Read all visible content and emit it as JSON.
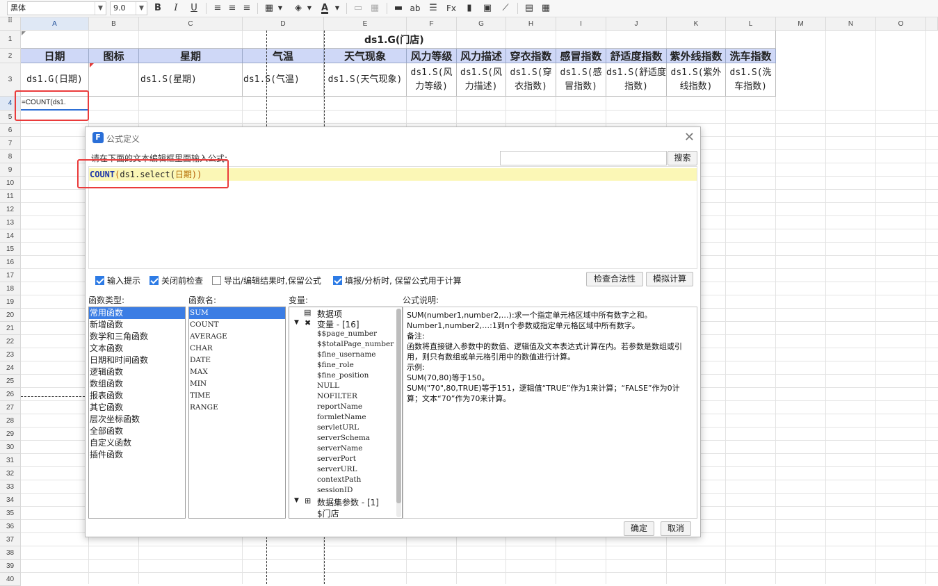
{
  "toolbar": {
    "font_name": "黑体",
    "font_size": "9.0",
    "bold": "B",
    "italic": "I",
    "underline": "U",
    "font_color_glyph": "A",
    "text_ab": "ab",
    "fx": "Fx"
  },
  "sheet": {
    "columns": [
      "A",
      "B",
      "C",
      "D",
      "E",
      "F",
      "G",
      "H",
      "I",
      "J",
      "K",
      "L",
      "M",
      "N",
      "O"
    ],
    "rows": [
      "1",
      "2",
      "3",
      "4",
      "5",
      "6",
      "7",
      "8",
      "9",
      "10",
      "11",
      "12",
      "13",
      "14",
      "15",
      "16",
      "17",
      "18",
      "19",
      "20",
      "21",
      "22",
      "23",
      "24",
      "25",
      "26",
      "27",
      "28",
      "29",
      "30",
      "31",
      "32",
      "33",
      "34",
      "35",
      "36",
      "37",
      "38",
      "39",
      "40"
    ],
    "title_cell": "ds1.G(门店)",
    "headers": [
      "日期",
      "图标",
      "星期",
      "气温",
      "天气现象",
      "风力等级",
      "风力描述",
      "穿衣指数",
      "感冒指数",
      "舒适度指数",
      "紫外线指数",
      "洗车指数"
    ],
    "data_cells": [
      "ds1.G(日期)",
      "",
      "ds1.S(星期)",
      "ds1.S(气温)",
      "ds1.S(天气现象)",
      "ds1.S(风力等级)",
      "ds1.S(风力描述)",
      "ds1.S(穿衣指数)",
      "ds1.S(感冒指数)",
      "ds1.S(舒适度指数)",
      "ds1.S(紫外线指数)",
      "ds1.S(洗车指数)"
    ],
    "editing_cell": "=COUNT(ds1."
  },
  "dialog": {
    "title": "公式定义",
    "prompt": "请在下面的文本编辑框里面输入公式:",
    "search_button": "搜索",
    "formula": {
      "func": "COUNT",
      "open": "(",
      "body": "ds1.select(",
      "arg": "日期",
      "close": "))"
    },
    "options": [
      {
        "label": "输入提示",
        "checked": true
      },
      {
        "label": "关闭前检查",
        "checked": true
      },
      {
        "label": "导出/编辑结果时,保留公式",
        "checked": false
      },
      {
        "label": "填报/分析时, 保留公式用于计算",
        "checked": true
      }
    ],
    "check_validity_button": "检查合法性",
    "simulate_button": "模拟计算",
    "func_type_label": "函数类型:",
    "func_name_label": "函数名:",
    "variable_label": "变量:",
    "desc_label": "公式说明:",
    "func_types": [
      "常用函数",
      "新增函数",
      "数学和三角函数",
      "文本函数",
      "日期和时间函数",
      "逻辑函数",
      "数组函数",
      "报表函数",
      "其它函数",
      "层次坐标函数",
      "全部函数",
      "自定义函数",
      "插件函数"
    ],
    "func_names": [
      "SUM",
      "COUNT",
      "AVERAGE",
      "CHAR",
      "DATE",
      "MAX",
      "MIN",
      "TIME",
      "RANGE"
    ],
    "variables": {
      "data_item": "数据项",
      "var_group": "变量 - [16]",
      "var_items": [
        "$$page_number",
        "$$totalPage_number",
        "$fine_username",
        "$fine_role",
        "$fine_position",
        "NULL",
        "NOFILTER",
        "reportName",
        "formletName",
        "servletURL",
        "serverSchema",
        "serverName",
        "serverPort",
        "serverURL",
        "contextPath",
        "sessionID"
      ],
      "dataset_group": "数据集参数 - [1]",
      "dataset_items": [
        "$门店"
      ]
    },
    "description": [
      "SUM(number1,number2,…):求一个指定单元格区域中所有数字之和。",
      "Number1,number2,…:1到n个参数或指定单元格区域中所有数字。",
      "备注:",
      "函数将直接键入参数中的数值、逻辑值及文本表达式计算在内。若参数是数组或引用，则只有数组或单元格引用中的数值进行计算。",
      "示例:",
      "SUM(70,80)等于150。",
      "SUM(\"70\",80,TRUE)等于151，逻辑值“TRUE”作为1来计算；“FALSE”作为0计算；文本“70”作为70来计算。"
    ],
    "ok_button": "确定",
    "cancel_button": "取消"
  }
}
